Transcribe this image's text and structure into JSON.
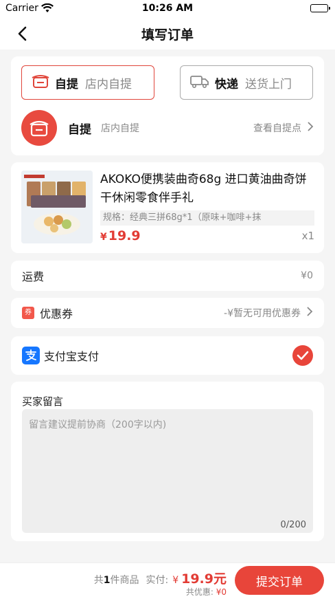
{
  "status_bar": {
    "carrier": "Carrier",
    "time": "10:26 AM"
  },
  "nav": {
    "title": "填写订单"
  },
  "delivery": {
    "tabs": [
      {
        "main": "自提",
        "sub": "店内自提",
        "selected": true
      },
      {
        "main": "快递",
        "sub": "送货上门",
        "selected": false
      }
    ],
    "pickup_row": {
      "main": "自提",
      "sub": "店内自提",
      "link": "查看自提点"
    }
  },
  "product": {
    "title": "AKOKO便携装曲奇68g 进口黄油曲奇饼干休闲零食伴手礼",
    "spec": "规格：经典三拼68g*1（原味+咖啡+抹",
    "currency": "¥",
    "price": "19.9",
    "qty": "x1"
  },
  "shipping": {
    "label": "运费",
    "value": "¥0"
  },
  "coupon": {
    "icon_text": "券",
    "label": "优惠券",
    "value": "-¥暂无可用优惠券"
  },
  "payment": {
    "label": "支付宝支付"
  },
  "message": {
    "label": "买家留言",
    "placeholder": "留言建议提前协商（200字以内)",
    "counter": "0/200"
  },
  "summary": {
    "prefix": "共",
    "count": "1",
    "suffix": "件商品",
    "paid_label": "实付:",
    "currency": "¥",
    "total": "19.9元",
    "discount_label": "共优惠:",
    "discount_value": "¥0"
  },
  "submit": {
    "label": "提交订单"
  },
  "colors": {
    "accent": "#e8453a",
    "price": "#e23b34",
    "alipay": "#1677ff"
  }
}
